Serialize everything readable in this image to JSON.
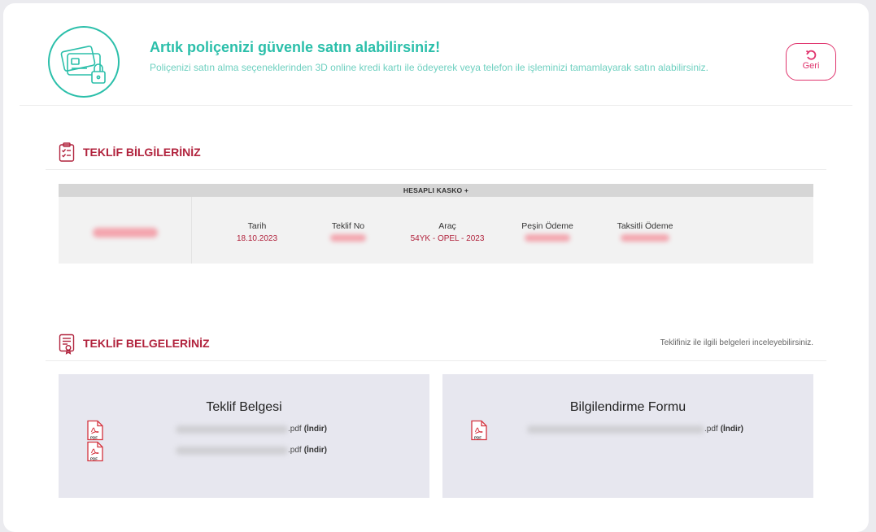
{
  "hero": {
    "title": "Artık poliçenizi güvenle satın alabilirsiniz!",
    "description": "Poliçenizi satın alma seçeneklerinden 3D online kredi kartı ile ödeyerek veya telefon ile işleminizi tamamlayarak satın alabilirsiniz.",
    "back_label": "Geri"
  },
  "offer_section": {
    "title": "TEKLİF BİLGİLERİNİZ",
    "product": "HESAPLI KASKO +",
    "columns": [
      {
        "label": "Tarih",
        "value": "18.10.2023"
      },
      {
        "label": "Teklif No",
        "value": ""
      },
      {
        "label": "Araç",
        "value": "54YK - OPEL - 2023"
      },
      {
        "label": "Peşin Ödeme",
        "value": ""
      },
      {
        "label": "Taksitli Ödeme",
        "value": ""
      }
    ]
  },
  "docs_section": {
    "title": "TEKLİF BELGELERİNİZ",
    "note": "Teklifiniz ile ilgili belgeleri inceleyebilirsiniz.",
    "cards": [
      {
        "title": "Teklif Belgesi",
        "files": [
          {
            "ext": ".pdf",
            "action": "(İndir)"
          },
          {
            "ext": ".pdf",
            "action": "(İndir)"
          }
        ]
      },
      {
        "title": "Bilgilendirme Formu",
        "files": [
          {
            "ext": ".pdf",
            "action": "(İndir)"
          }
        ]
      }
    ]
  },
  "colors": {
    "accent_teal": "#2bbfaa",
    "accent_red": "#b1233d",
    "accent_pink": "#e0356e"
  }
}
